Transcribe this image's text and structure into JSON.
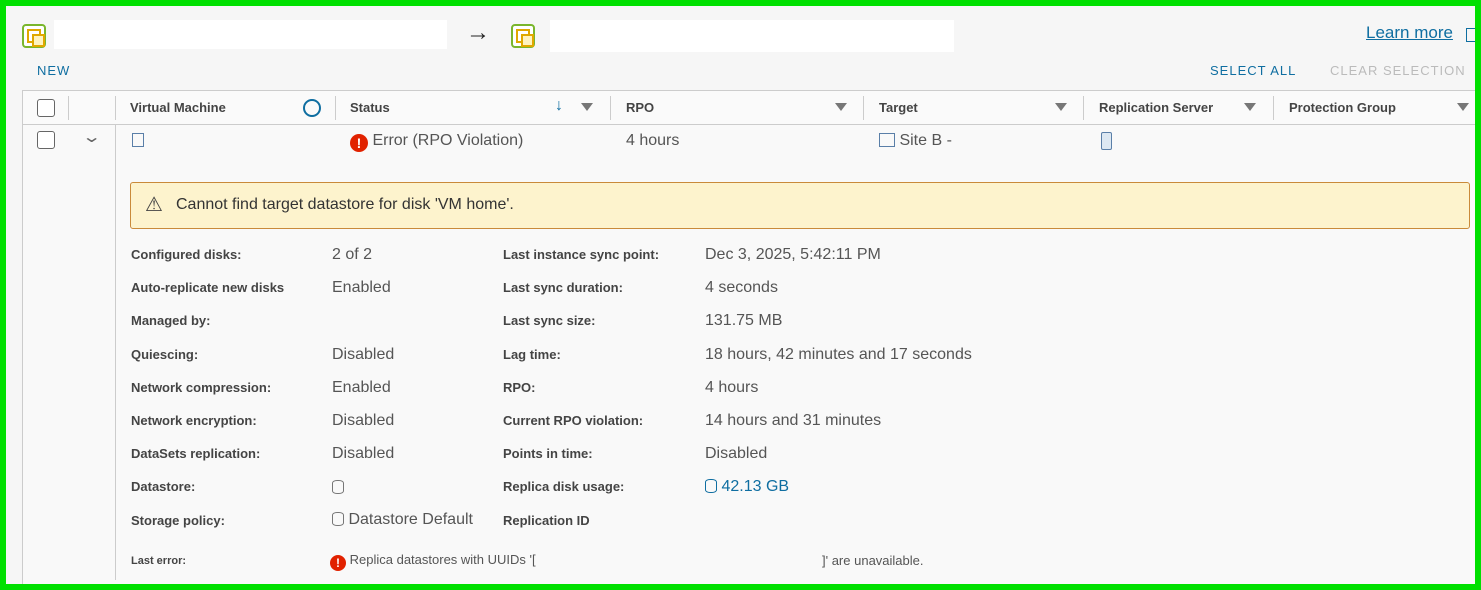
{
  "header": {
    "learn_more": "Learn more",
    "arrow": "→"
  },
  "toolbar": {
    "new": "NEW",
    "select_all": "SELECT ALL",
    "clear_selection": "CLEAR SELECTION"
  },
  "table": {
    "columns": [
      "Virtual Machine",
      "Status",
      "RPO",
      "Target",
      "Replication Server",
      "Protection Group"
    ],
    "row": {
      "status": "Error (RPO Violation)",
      "rpo": "4 hours",
      "target": "Site B -"
    }
  },
  "alert": {
    "message": "Cannot find target datastore for disk 'VM home'."
  },
  "details": {
    "left": [
      {
        "label": "Configured disks:",
        "value": "2 of 2"
      },
      {
        "label": "Auto-replicate new disks",
        "value": "Enabled"
      },
      {
        "label": "Managed by:",
        "value": ""
      },
      {
        "label": "Quiescing:",
        "value": "Disabled"
      },
      {
        "label": "Network compression:",
        "value": "Enabled"
      },
      {
        "label": "Network encryption:",
        "value": "Disabled"
      },
      {
        "label": "DataSets replication:",
        "value": "Disabled"
      },
      {
        "label": "Datastore:",
        "value": ""
      },
      {
        "label": "Storage policy:",
        "value": "Datastore Default"
      }
    ],
    "right": [
      {
        "label": "Last instance sync point:",
        "value": "Dec 3, 2025, 5:42:11 PM"
      },
      {
        "label": "Last sync duration:",
        "value": "4 seconds"
      },
      {
        "label": "Last sync size:",
        "value": "131.75 MB"
      },
      {
        "label": "Lag time:",
        "value": "18 hours, 42 minutes and 17 seconds"
      },
      {
        "label": "RPO:",
        "value": "4 hours"
      },
      {
        "label": "Current RPO violation:",
        "value": "14 hours and 31 minutes"
      },
      {
        "label": "Points in time:",
        "value": "Disabled"
      },
      {
        "label": "Replica disk usage:",
        "value": "42.13 GB"
      },
      {
        "label": "Replication ID",
        "value": ""
      }
    ],
    "last_error_label": "Last error:",
    "last_error_prefix": "Replica datastores with UUIDs '[",
    "last_error_suffix": "]' are unavailable."
  },
  "colors": {
    "accent": "#0f6ea1",
    "error": "#e12200",
    "warning_bg": "#fdf3cd"
  }
}
